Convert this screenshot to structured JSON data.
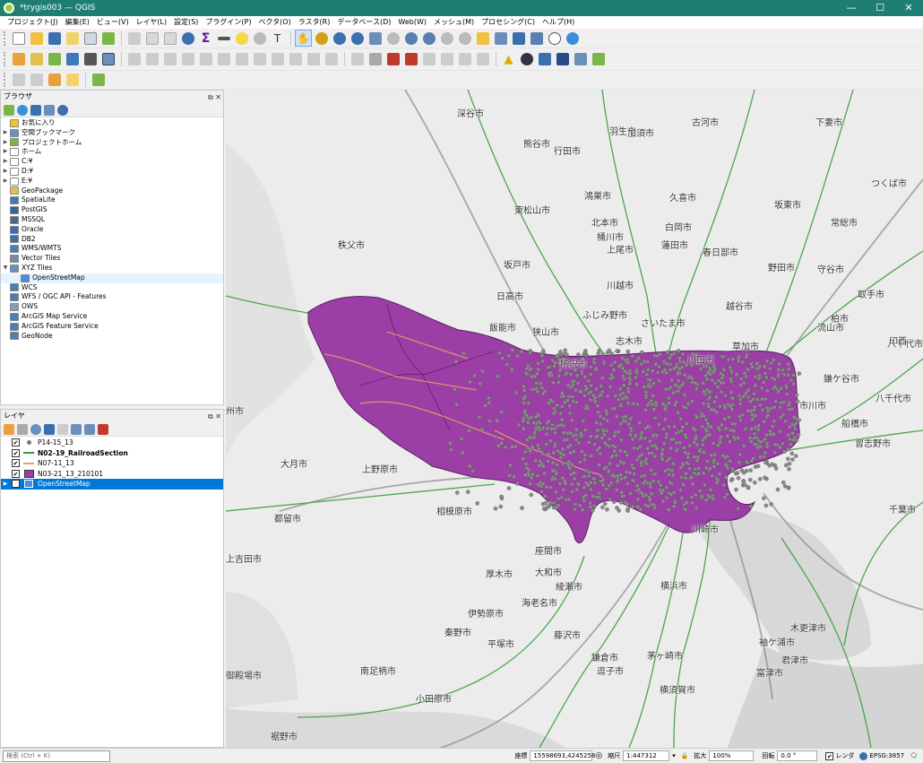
{
  "window": {
    "title": "*trygis003 — QGIS",
    "minimize": "—",
    "maximize": "☐",
    "close": "✕"
  },
  "menus": [
    "プロジェクト(J)",
    "編集(E)",
    "ビュー(V)",
    "レイヤ(L)",
    "設定(S)",
    "プラグイン(P)",
    "ベクタ(O)",
    "ラスタ(R)",
    "データベース(D)",
    "Web(W)",
    "メッシュ(M)",
    "プロセシング(C)",
    "ヘルプ(H)"
  ],
  "browser": {
    "title": "ブラウザ",
    "items": [
      {
        "label": "お気に入り",
        "icon": "star-icon",
        "color": "#f5c518",
        "expand": ""
      },
      {
        "label": "空間ブックマーク",
        "icon": "bookmark-icon",
        "color": "#6a8fc4",
        "expand": "▶"
      },
      {
        "label": "プロジェクトホーム",
        "icon": "project-home-icon",
        "color": "#7ab648",
        "expand": "▶"
      },
      {
        "label": "ホーム",
        "icon": "home-folder-icon",
        "color": "#ffffff",
        "expand": "▶"
      },
      {
        "label": "C:¥",
        "icon": "drive-icon",
        "color": "#ffffff",
        "expand": "▶"
      },
      {
        "label": "D:¥",
        "icon": "drive-icon",
        "color": "#ffffff",
        "expand": "▶"
      },
      {
        "label": "E:¥",
        "icon": "drive-icon",
        "color": "#ffffff",
        "expand": "▶"
      },
      {
        "label": "GeoPackage",
        "icon": "geopackage-icon",
        "color": "#e2c04a",
        "expand": ""
      },
      {
        "label": "SpatiaLite",
        "icon": "spatialite-icon",
        "color": "#3d7ab8",
        "expand": ""
      },
      {
        "label": "PostGIS",
        "icon": "postgis-icon",
        "color": "#33669a",
        "expand": ""
      },
      {
        "label": "MSSQL",
        "icon": "mssql-icon",
        "color": "#55658a",
        "expand": ""
      },
      {
        "label": "Oracle",
        "icon": "oracle-icon",
        "color": "#3a6fb0",
        "expand": ""
      },
      {
        "label": "DB2",
        "icon": "db2-icon",
        "color": "#3a6fb0",
        "expand": ""
      },
      {
        "label": "WMS/WMTS",
        "icon": "wms-icon",
        "color": "#4a7fb5",
        "expand": ""
      },
      {
        "label": "Vector Tiles",
        "icon": "vector-tiles-icon",
        "color": "#7a8aa0",
        "expand": ""
      },
      {
        "label": "XYZ Tiles",
        "icon": "xyz-tiles-icon",
        "color": "#6b8fbd",
        "expand": "▼"
      },
      {
        "label": "OpenStreetMap",
        "icon": "osm-tile-icon",
        "color": "#4a90d9",
        "expand": "",
        "child": true
      },
      {
        "label": "WCS",
        "icon": "wcs-icon",
        "color": "#4a7fb5",
        "expand": ""
      },
      {
        "label": "WFS / OGC API - Features",
        "icon": "wfs-icon",
        "color": "#4a7fb5",
        "expand": ""
      },
      {
        "label": "OWS",
        "icon": "ows-icon",
        "color": "#8a9ab0",
        "expand": ""
      },
      {
        "label": "ArcGIS Map Service",
        "icon": "arcgis-map-icon",
        "color": "#4a7fb5",
        "expand": ""
      },
      {
        "label": "ArcGIS Feature Service",
        "icon": "arcgis-feature-icon",
        "color": "#4a7fb5",
        "expand": ""
      },
      {
        "label": "GeoNode",
        "icon": "geonode-icon",
        "color": "#4a7fb5",
        "expand": ""
      }
    ]
  },
  "layers": {
    "title": "レイヤ",
    "items": [
      {
        "label": "P14-15_13",
        "checked": "✔",
        "symbol": "point",
        "color": "#777777",
        "bold": false
      },
      {
        "label": "N02-19_RailroadSection",
        "checked": "✔",
        "symbol": "line",
        "color": "#3a9a3a",
        "bold": true
      },
      {
        "label": "N07-11_13",
        "checked": "✔",
        "symbol": "line",
        "color": "#e8a060",
        "bold": false
      },
      {
        "label": "N03-21_13_210101",
        "checked": "✔",
        "symbol": "fill",
        "color": "#9b3fa6",
        "bold": false
      },
      {
        "label": "OpenStreetMap",
        "checked": "✔",
        "symbol": "raster",
        "color": "#4a90d9",
        "bold": false,
        "selected": true
      }
    ]
  },
  "map": {
    "places": [
      {
        "name": "深谷市",
        "cls": ""
      },
      {
        "name": "古河市",
        "cls": ""
      },
      {
        "name": "下妻市",
        "cls": ""
      },
      {
        "name": "羽生市",
        "cls": ""
      },
      {
        "name": "熊谷市",
        "cls": ""
      },
      {
        "name": "行田市",
        "cls": ""
      },
      {
        "name": "加須市",
        "cls": ""
      },
      {
        "name": "東松山市",
        "cls": ""
      },
      {
        "name": "鴻巣市",
        "cls": ""
      },
      {
        "name": "久喜市",
        "cls": ""
      },
      {
        "name": "つくば市",
        "cls": ""
      },
      {
        "name": "坂東市",
        "cls": ""
      },
      {
        "name": "北本市",
        "cls": ""
      },
      {
        "name": "桶川市",
        "cls": ""
      },
      {
        "name": "白岡市",
        "cls": ""
      },
      {
        "name": "蓮田市",
        "cls": ""
      },
      {
        "name": "常総市",
        "cls": ""
      },
      {
        "name": "秩父市",
        "cls": ""
      },
      {
        "name": "坂戸市",
        "cls": ""
      },
      {
        "name": "上尾市",
        "cls": ""
      },
      {
        "name": "春日部市",
        "cls": ""
      },
      {
        "name": "野田市",
        "cls": ""
      },
      {
        "name": "守谷市",
        "cls": ""
      },
      {
        "name": "川越市",
        "cls": ""
      },
      {
        "name": "日高市",
        "cls": ""
      },
      {
        "name": "越谷市",
        "cls": ""
      },
      {
        "name": "取手市",
        "cls": ""
      },
      {
        "name": "ふじみ野市",
        "cls": ""
      },
      {
        "name": "さいたま市",
        "cls": ""
      },
      {
        "name": "柏市",
        "cls": ""
      },
      {
        "name": "飯能市",
        "cls": ""
      },
      {
        "name": "狭山市",
        "cls": ""
      },
      {
        "name": "流山市",
        "cls": ""
      },
      {
        "name": "志木市",
        "cls": ""
      },
      {
        "name": "草加市",
        "cls": ""
      },
      {
        "name": "川口市",
        "cls": ""
      },
      {
        "name": "所沢市",
        "cls": ""
      },
      {
        "name": "鎌ケ谷市",
        "cls": ""
      },
      {
        "name": "八千代市",
        "cls": ""
      },
      {
        "name": "市川市",
        "cls": ""
      },
      {
        "name": "船橋市",
        "cls": ""
      },
      {
        "name": "習志野市",
        "cls": ""
      },
      {
        "name": "大月市",
        "cls": ""
      },
      {
        "name": "上野原市",
        "cls": ""
      },
      {
        "name": "相模原市",
        "cls": ""
      },
      {
        "name": "都留市",
        "cls": ""
      },
      {
        "name": "上吉田市",
        "cls": ""
      },
      {
        "name": "座間市",
        "cls": ""
      },
      {
        "name": "大和市",
        "cls": ""
      },
      {
        "name": "厚木市",
        "cls": ""
      },
      {
        "name": "綾瀬市",
        "cls": ""
      },
      {
        "name": "海老名市",
        "cls": ""
      },
      {
        "name": "横浜市",
        "cls": ""
      },
      {
        "name": "伊勢原市",
        "cls": ""
      },
      {
        "name": "秦野市",
        "cls": ""
      },
      {
        "name": "藤沢市",
        "cls": ""
      },
      {
        "name": "平塚市",
        "cls": ""
      },
      {
        "name": "鎌倉市",
        "cls": ""
      },
      {
        "name": "茅ヶ崎市",
        "cls": ""
      },
      {
        "name": "逗子市",
        "cls": ""
      },
      {
        "name": "南足柄市",
        "cls": ""
      },
      {
        "name": "横須賀市",
        "cls": ""
      },
      {
        "name": "小田原市",
        "cls": ""
      },
      {
        "name": "御殿場市",
        "cls": ""
      },
      {
        "name": "裾野市",
        "cls": ""
      },
      {
        "name": "袖ケ浦市",
        "cls": ""
      },
      {
        "name": "木更津市",
        "cls": ""
      },
      {
        "name": "君津市",
        "cls": ""
      },
      {
        "name": "富津市",
        "cls": ""
      },
      {
        "name": "千葉市",
        "cls": ""
      },
      {
        "name": "八千代市",
        "cls": ""
      },
      {
        "name": "印西",
        "cls": ""
      },
      {
        "name": "州市",
        "cls": ""
      },
      {
        "name": "川崎市",
        "cls": ""
      }
    ]
  },
  "status": {
    "search_placeholder": "検索 (Ctrl + K)",
    "coord_label": "座標",
    "coord_value": "15598693,4245258",
    "scale_label": "縮尺",
    "scale_value": "1:447312",
    "magnify_label": "拡大",
    "magnify_value": "100%",
    "rotation_label": "回転",
    "rotation_value": "0.0 °",
    "render_label": "レンダ",
    "crs": "EPSG:3857"
  }
}
